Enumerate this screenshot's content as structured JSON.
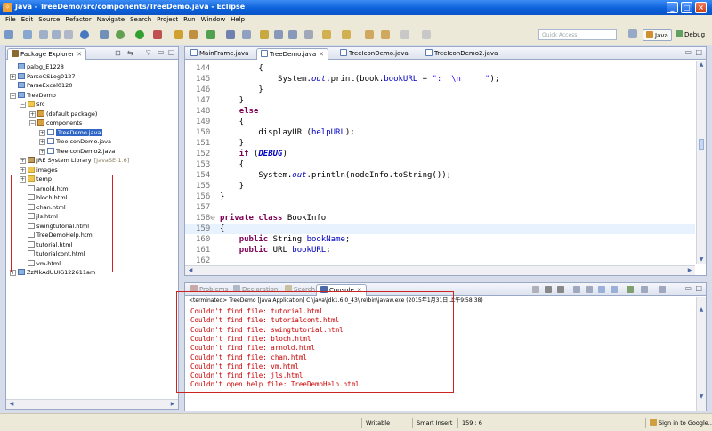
{
  "window": {
    "title": "Java - TreeDemo/src/components/TreeDemo.java - Eclipse",
    "controls": [
      "_",
      "□",
      "×"
    ]
  },
  "menu": [
    "File",
    "Edit",
    "Source",
    "Refactor",
    "Navigate",
    "Search",
    "Project",
    "Run",
    "Window",
    "Help"
  ],
  "toolbar": {
    "quick_access_placeholder": "Quick Access",
    "perspectives": [
      "Java",
      "Debug"
    ]
  },
  "package_explorer": {
    "tab_label": "Package Explorer",
    "tree": [
      {
        "label": "palog_E1228",
        "icon": "project-icon",
        "level": 0,
        "twisty": ""
      },
      {
        "label": "ParseCSLog0127",
        "icon": "project-icon",
        "level": 0,
        "twisty": "+"
      },
      {
        "label": "ParseExcel0120",
        "icon": "project-icon",
        "level": 0,
        "twisty": ""
      },
      {
        "label": "TreeDemo",
        "icon": "project-icon",
        "level": 0,
        "twisty": "−"
      },
      {
        "label": "src",
        "icon": "source-folder-icon",
        "level": 1,
        "twisty": "−"
      },
      {
        "label": "(default package)",
        "icon": "package-icon",
        "level": 2,
        "twisty": "+"
      },
      {
        "label": "components",
        "icon": "package-icon",
        "level": 2,
        "twisty": "−"
      },
      {
        "label": "TreeDemo.java",
        "icon": "java-file-icon",
        "level": 3,
        "twisty": "+",
        "selected": true
      },
      {
        "label": "TreeIconDemo.java",
        "icon": "java-file-icon",
        "level": 3,
        "twisty": "+"
      },
      {
        "label": "TreeIconDemo2.java",
        "icon": "java-file-icon",
        "level": 3,
        "twisty": "+"
      },
      {
        "label": "JRE System Library",
        "suffix": "[JavaSE-1.6]",
        "icon": "library-icon",
        "level": 1,
        "twisty": "+"
      },
      {
        "label": "images",
        "icon": "folder-icon",
        "level": 1,
        "twisty": "+"
      },
      {
        "label": "temp",
        "icon": "folder-icon",
        "level": 1,
        "twisty": "+"
      },
      {
        "label": "arnold.html",
        "icon": "html-file-icon",
        "level": 1,
        "twisty": ""
      },
      {
        "label": "bloch.html",
        "icon": "html-file-icon",
        "level": 1,
        "twisty": ""
      },
      {
        "label": "chan.html",
        "icon": "html-file-icon",
        "level": 1,
        "twisty": ""
      },
      {
        "label": "jls.html",
        "icon": "html-file-icon",
        "level": 1,
        "twisty": ""
      },
      {
        "label": "swingtutorial.html",
        "icon": "html-file-icon",
        "level": 1,
        "twisty": ""
      },
      {
        "label": "TreeDemoHelp.html",
        "icon": "html-file-icon",
        "level": 1,
        "twisty": ""
      },
      {
        "label": "tutorial.html",
        "icon": "html-file-icon",
        "level": 1,
        "twisty": ""
      },
      {
        "label": "tutorialcont.html",
        "icon": "html-file-icon",
        "level": 1,
        "twisty": ""
      },
      {
        "label": "vm.html",
        "icon": "html-file-icon",
        "level": 1,
        "twisty": ""
      },
      {
        "label": "ZzMkAdUUIG122611am",
        "icon": "project-icon",
        "level": 0,
        "twisty": "+"
      }
    ]
  },
  "editor": {
    "tabs": [
      "MainFrame.java",
      "TreeDemo.java",
      "TreeIconDemo.java",
      "TreeIconDemo2.java"
    ],
    "active_tab": 1,
    "current_line": "159"
  },
  "console_view": {
    "tabs": [
      "Problems",
      "Declaration",
      "Search",
      "Console"
    ],
    "active_tab": 3,
    "header": "<terminated> TreeDemo [Java Application] C:\\java\\jdk1.6.0_43\\jre\\bin\\javaw.exe (2015年1月31日 上午9:58:38)",
    "lines": [
      "Couldn't find file: tutorial.html",
      "Couldn't find file: tutorialcont.html",
      "Couldn't find file: swingtutorial.html",
      "Couldn't find file: bloch.html",
      "Couldn't find file: arnold.html",
      "Couldn't find file: chan.html",
      "Couldn't find file: vm.html",
      "Couldn't find file: jls.html",
      "Couldn't open help file: TreeDemoHelp.html"
    ]
  },
  "statusbar": {
    "mode": "Writable",
    "insert": "Smart Insert",
    "position": "159 : 6",
    "signin": "Sign in to Google..."
  },
  "colors": {
    "keyword": "#7f0055",
    "field": "#0000c0",
    "string": "#2a00ff",
    "console_error": "#cc0000",
    "annotation_box": "#cc2222"
  }
}
